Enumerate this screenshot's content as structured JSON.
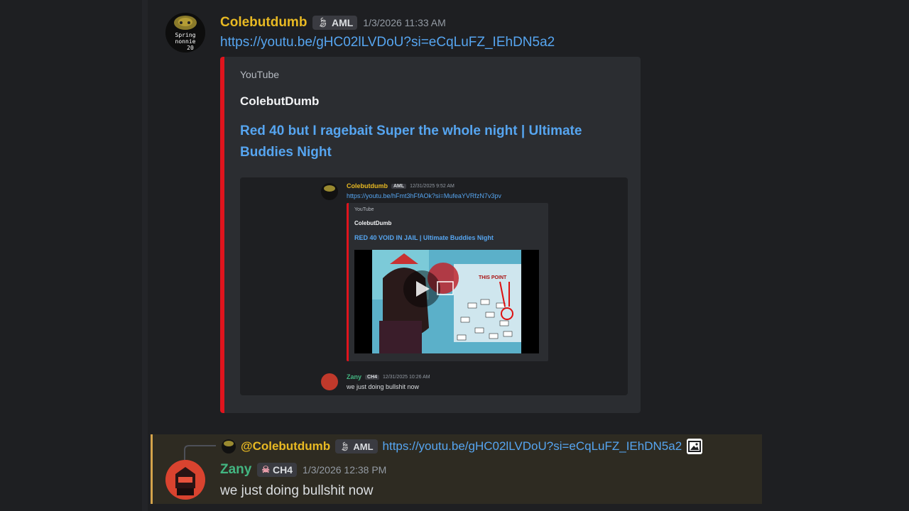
{
  "message1": {
    "author": "Colebutdumb",
    "tag": "AML",
    "timestamp": "1/3/2026 11:33 AM",
    "link": "https://youtu.be/gHC02lLVDoU?si=eCqLuFZ_IEhDN5a2",
    "avatar_text": [
      "Spring",
      "nonnie",
      "20"
    ]
  },
  "embed": {
    "provider": "YouTube",
    "author": "ColebutDumb",
    "title": "Red 40 but I ragebait Super the whole night | Ultimate Buddies Night"
  },
  "thumbnail": {
    "author": "Colebutdumb",
    "tag": "AML",
    "timestamp": "12/31/2025 9:52 AM",
    "link": "https://youtu.be/hFmt3hFfAOk?si=MufeaYVRfzN7v3pv",
    "embed_provider": "YouTube",
    "embed_author": "ColebutDumb",
    "embed_title": "RED 40 VOID IN JAIL | Ultimate Buddies Night",
    "video_caption": "THIS POINT",
    "reply_author": "Zany",
    "reply_tag": "CH4",
    "reply_timestamp": "12/31/2025 10:26 AM",
    "reply_text": "we just doing bullshit now"
  },
  "message2": {
    "reply_mention": "@Colebutdumb",
    "reply_tag": "AML",
    "reply_link": "https://youtu.be/gHC02lLVDoU?si=eCqLuFZ_IEhDN5a2",
    "author": "Zany",
    "tag": "CH4",
    "timestamp": "1/3/2026 12:38 PM",
    "text": "we just doing bullshit now"
  },
  "colors": {
    "author1": "#e8b923",
    "author2": "#43b581",
    "link": "#56a5f0",
    "embed_bar": "#e0141d",
    "highlight_bar": "#d4a34b"
  }
}
